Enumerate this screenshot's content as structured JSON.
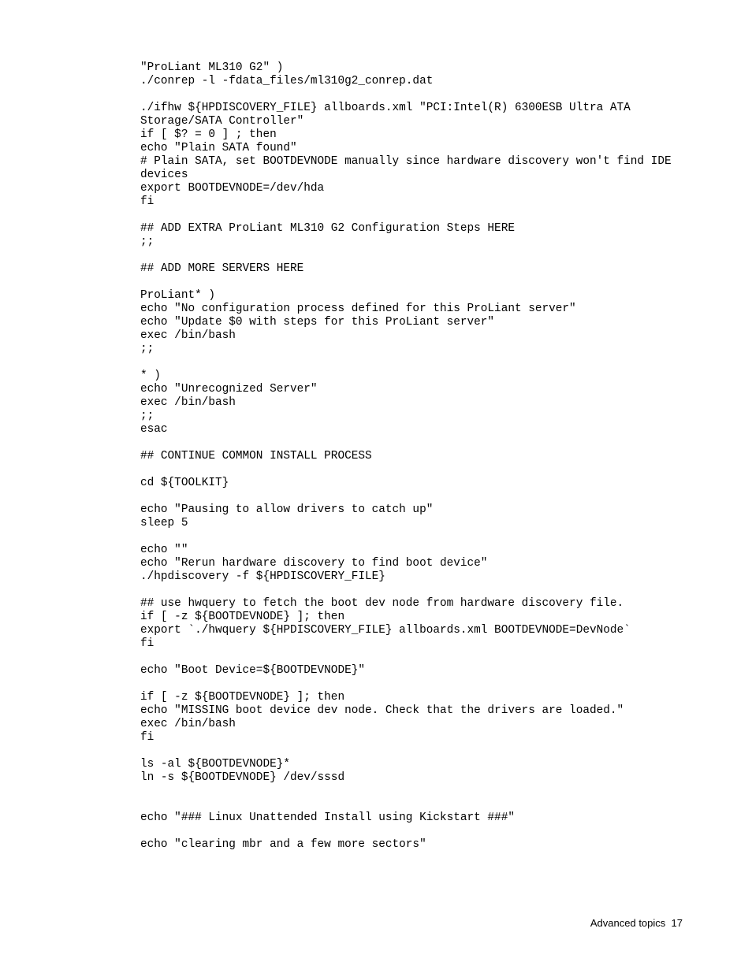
{
  "code": "\"ProLiant ML310 G2\" )\n./conrep -l -fdata_files/ml310g2_conrep.dat\n\n./ifhw ${HPDISCOVERY_FILE} allboards.xml \"PCI:Intel(R) 6300ESB Ultra ATA Storage/SATA Controller\"\nif [ $? = 0 ] ; then\necho \"Plain SATA found\"\n# Plain SATA, set BOOTDEVNODE manually since hardware discovery won't find IDE devices\nexport BOOTDEVNODE=/dev/hda\nfi\n\n## ADD EXTRA ProLiant ML310 G2 Configuration Steps HERE\n;;\n\n## ADD MORE SERVERS HERE\n\nProLiant* )\necho \"No configuration process defined for this ProLiant server\"\necho \"Update $0 with steps for this ProLiant server\"\nexec /bin/bash\n;;\n\n* )\necho \"Unrecognized Server\"\nexec /bin/bash\n;;\nesac\n\n## CONTINUE COMMON INSTALL PROCESS\n\ncd ${TOOLKIT}\n\necho \"Pausing to allow drivers to catch up\"\nsleep 5\n\necho \"\"\necho \"Rerun hardware discovery to find boot device\"\n./hpdiscovery -f ${HPDISCOVERY_FILE}\n\n## use hwquery to fetch the boot dev node from hardware discovery file.\nif [ -z ${BOOTDEVNODE} ]; then\nexport `./hwquery ${HPDISCOVERY_FILE} allboards.xml BOOTDEVNODE=DevNode`\nfi\n\necho \"Boot Device=${BOOTDEVNODE}\"\n\nif [ -z ${BOOTDEVNODE} ]; then\necho \"MISSING boot device dev node. Check that the drivers are loaded.\"\nexec /bin/bash\nfi\n\nls -al ${BOOTDEVNODE}*\nln -s ${BOOTDEVNODE} /dev/sssd\n\n\necho \"### Linux Unattended Install using Kickstart ###\"\n\necho \"clearing mbr and a few more sectors\"",
  "footer": {
    "section": "Advanced topics",
    "page": "17"
  }
}
